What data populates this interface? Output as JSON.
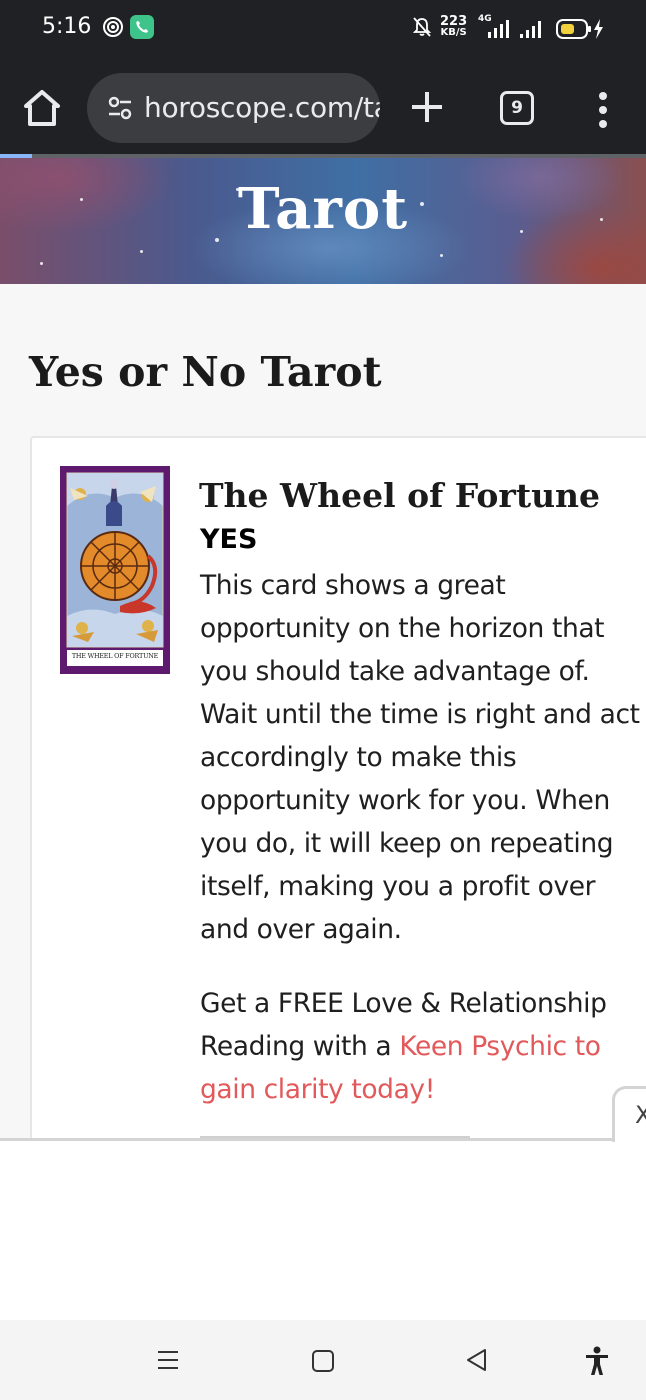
{
  "status_bar": {
    "time": "5:16",
    "net_speed_value": "223",
    "net_speed_unit": "KB/S",
    "network_label": "4G"
  },
  "browser": {
    "url": "horoscope.com/tarot",
    "tab_count": "9",
    "load_progress": 0.05
  },
  "banner": {
    "title": "Tarot"
  },
  "page": {
    "heading": "Yes or No Tarot"
  },
  "card": {
    "image_caption": "THE WHEEL OF FORTUNE",
    "name": "The Wheel of Fortune",
    "answer": "YES",
    "description": "This card shows a great opportunity on the horizon that you should take advantage of. Wait until the time is right and act accordingly to make this opportunity work for you. When you do, it will keep on repeating itself, making you a profit over and over again.",
    "promo_text": "Get a FREE Love & Relationship Reading with a ",
    "promo_link": "Keen Psychic to gain clarity today!"
  },
  "ad": {
    "close_label": "X"
  },
  "colors": {
    "link": "#e2595b",
    "card_border_purple": "#5e1a6e",
    "toolbar_bg": "#202124"
  },
  "icons": {
    "home": "home-icon",
    "site_settings": "tune-icon",
    "new_tab": "plus-icon",
    "tabs": "tab-switcher-icon",
    "menu": "more-vert-icon",
    "nav_recents": "recents-icon",
    "nav_home": "square-home-icon",
    "nav_back": "back-triangle-icon",
    "nav_accessibility": "accessibility-icon"
  }
}
